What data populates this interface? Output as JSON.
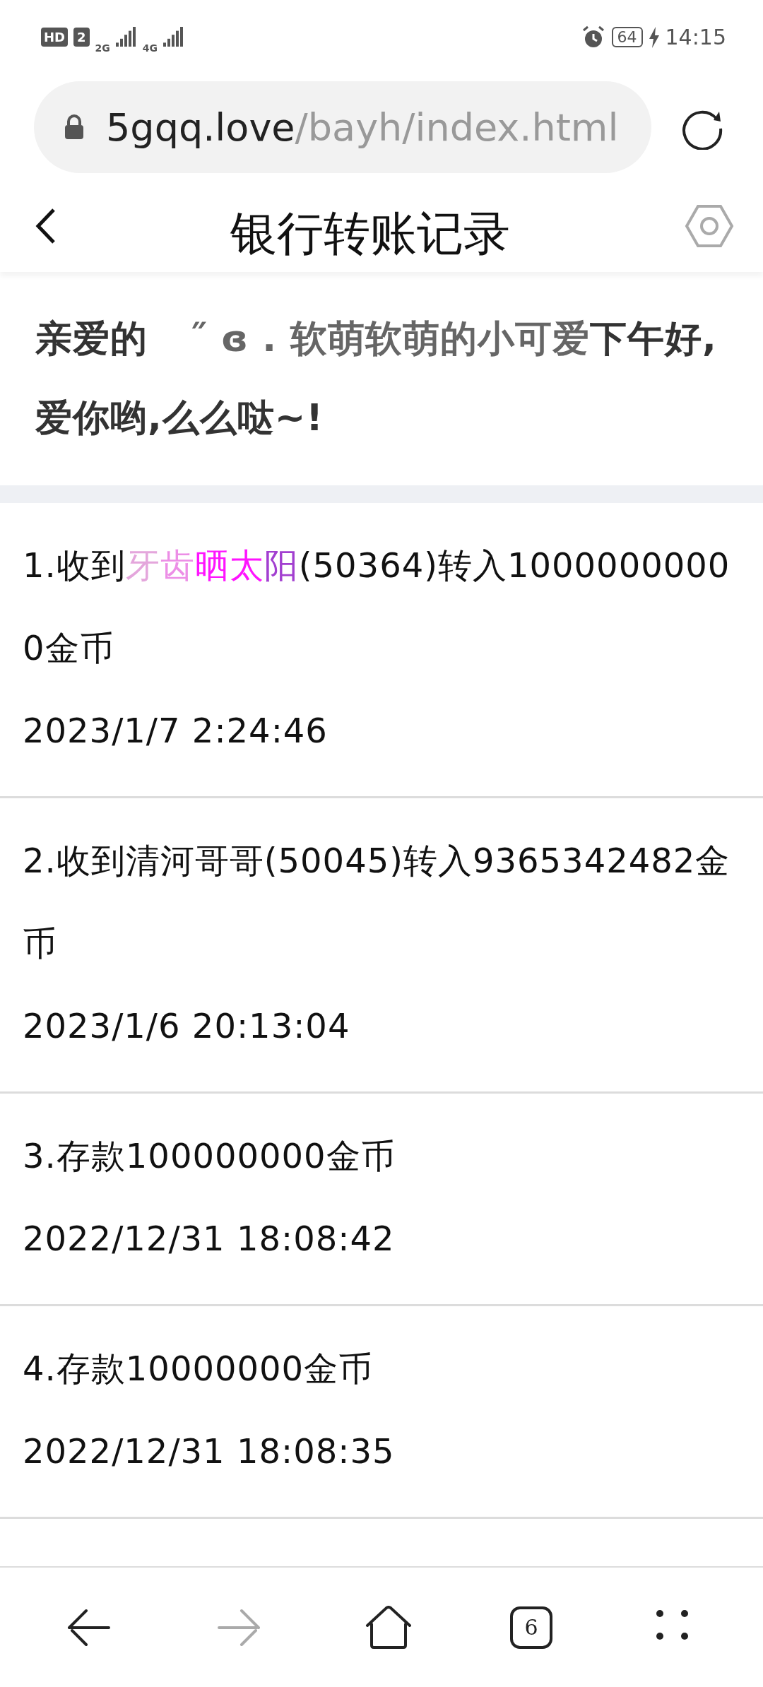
{
  "status_bar": {
    "hd": "HD",
    "sim": "2",
    "network_1": "2G",
    "network_2": "4G",
    "battery": "64",
    "time": "14:15"
  },
  "address_bar": {
    "host": "5gqq.love",
    "path": "/bayh/index.html"
  },
  "header": {
    "title": "银行转账记录"
  },
  "greeting": [
    {
      "text": "亲爱的",
      "kind": "plain"
    },
    {
      "text": "˝ ɞ . 软萌软萌的小可爱",
      "kind": "nickname"
    },
    {
      "text": "下午好,爱你哟,么么哒~!",
      "kind": "plain"
    }
  ],
  "records": [
    {
      "segments": [
        {
          "text": "1.收到"
        },
        {
          "text": "牙",
          "color": "#e4a6dc"
        },
        {
          "text": "齿",
          "color": "#ec8ee6"
        },
        {
          "text": "晒太",
          "color": "#ff14ff"
        },
        {
          "text": "阳",
          "color": "#a23fd0"
        },
        {
          "text": "(50364)转入10000000000金币"
        }
      ],
      "date": "2023/1/7 2:24:46"
    },
    {
      "segments": [
        {
          "text": "2.收到清河哥哥(50045)转入9365342482金币"
        }
      ],
      "date": "2023/1/6 20:13:04"
    },
    {
      "segments": [
        {
          "text": "3.存款100000000金币"
        }
      ],
      "date": "2022/12/31 18:08:42"
    },
    {
      "segments": [
        {
          "text": "4.存款10000000金币"
        }
      ],
      "date": "2022/12/31 18:08:35"
    }
  ],
  "bottom_nav": {
    "tab_count": "6"
  }
}
